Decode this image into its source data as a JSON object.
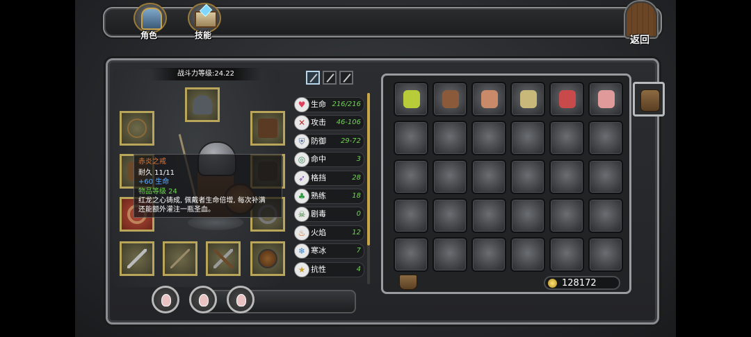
{
  "tabs": [
    {
      "label": "角色",
      "icon": "helmet-icon"
    },
    {
      "label": "技能",
      "icon": "skill-book-icon"
    }
  ],
  "back_button": {
    "label": "返回",
    "icon": "door-icon"
  },
  "character": {
    "power_level": "战斗力等级:24.22",
    "equipment_slots": [
      "helmet",
      "amulet",
      "chest-armor",
      "gloves",
      "bracers",
      "belt",
      "ring",
      "mace",
      "spear",
      "crossbow",
      "shield"
    ],
    "potion_slots": 3
  },
  "weapon_sets": [
    "sword",
    "spear",
    "bow"
  ],
  "stats": [
    {
      "label": "生命",
      "value": "216/216",
      "icon": "heart-icon"
    },
    {
      "label": "攻击",
      "value": "46-106",
      "icon": "crossed-swords-icon"
    },
    {
      "label": "防御",
      "value": "29-72",
      "icon": "shield-icon"
    },
    {
      "label": "命中",
      "value": "3",
      "icon": "target-icon"
    },
    {
      "label": "格挡",
      "value": "28",
      "icon": "dodge-icon"
    },
    {
      "label": "熟练",
      "value": "18",
      "icon": "clover-icon"
    },
    {
      "label": "剧毒",
      "value": "0",
      "icon": "skull-icon"
    },
    {
      "label": "火焰",
      "value": "12",
      "icon": "fire-icon"
    },
    {
      "label": "寒冰",
      "value": "7",
      "icon": "snowflake-icon"
    },
    {
      "label": "抗性",
      "value": "4",
      "icon": "star-icon"
    }
  ],
  "tooltip": {
    "name": "赤炎之戒",
    "durability": "耐久 11/11",
    "bonus": "+60 生命",
    "item_level": "物品等级 24",
    "desc_line1": "红龙之心铸成, 佩戴者生命倍增, 每次补满",
    "desc_line2": "还能额外灌注一瓶圣血。"
  },
  "inventory": {
    "rows": 5,
    "cols": 6,
    "items": [
      {
        "name": "potion-bottle-icon",
        "color": "#b8cc3a"
      },
      {
        "name": "clay-jug-icon",
        "color": "#8a5a3a"
      },
      {
        "name": "bread-icon",
        "color": "#c98a6a"
      },
      {
        "name": "rope-icon",
        "color": "#c8b87a"
      },
      {
        "name": "raw-meat-icon",
        "color": "#c84a4a"
      },
      {
        "name": "pork-icon",
        "color": "#e09a9a"
      }
    ]
  },
  "gold": "128172"
}
